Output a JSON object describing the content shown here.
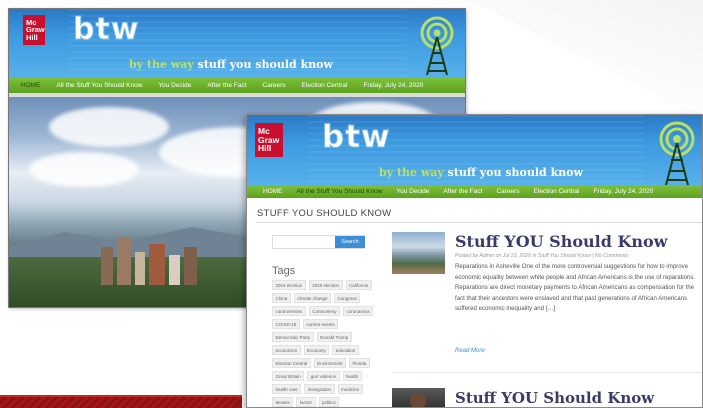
{
  "brand": {
    "logo_lines": [
      "Mc",
      "Graw",
      "Hill"
    ],
    "wordmark": "btw",
    "tagline_a": "by the way",
    "tagline_b": "stuff you should know"
  },
  "nav": {
    "items": [
      "HOME",
      "All the Stuff You Should Know",
      "You Decide",
      "After the Fact",
      "Careers",
      "Election Central"
    ],
    "date": "Friday, July 24, 2020"
  },
  "page": {
    "section_title": "STUFF YOU SHOULD KNOW"
  },
  "search": {
    "placeholder": "",
    "button_label": "Search"
  },
  "sidebar": {
    "tags_heading": "Tags",
    "tags": [
      "2016 election",
      "2020 election",
      "California",
      "China",
      "climate change",
      "Congress",
      "controversies",
      "Controversy",
      "coronavirus",
      "COVID-19",
      "current events",
      "Democratic Party",
      "Donald Trump",
      "economics",
      "Economy",
      "education",
      "Election Central",
      "Environment",
      "Florida",
      "Great Britain",
      "gun violence",
      "health",
      "health care",
      "immigration",
      "medicine",
      "Movies",
      "NASA",
      "politics"
    ]
  },
  "posts": [
    {
      "title": "Stuff YOU Should Know",
      "meta": "Posted by Admin on Jul 23, 2020 in Stuff You Should Know | No Comments",
      "body": "Reparations in Asheville One of the more controversial suggestions for how to improve economic equality between white people and African Americans is the use of reparations. Reparations are direct monetary payments to African Americans as compensation for the fact that their ancestors were enslaved and that past generations of African Americans suffered economic inequality and […]",
      "read_more": "Read More"
    },
    {
      "title": "Stuff YOU Should Know"
    }
  ],
  "colors": {
    "header_blue": "#3d9ae0",
    "nav_green": "#6eb12d",
    "brand_red": "#c8102e",
    "link_blue": "#3a8fd6",
    "title_navy": "#3b3b6b"
  }
}
